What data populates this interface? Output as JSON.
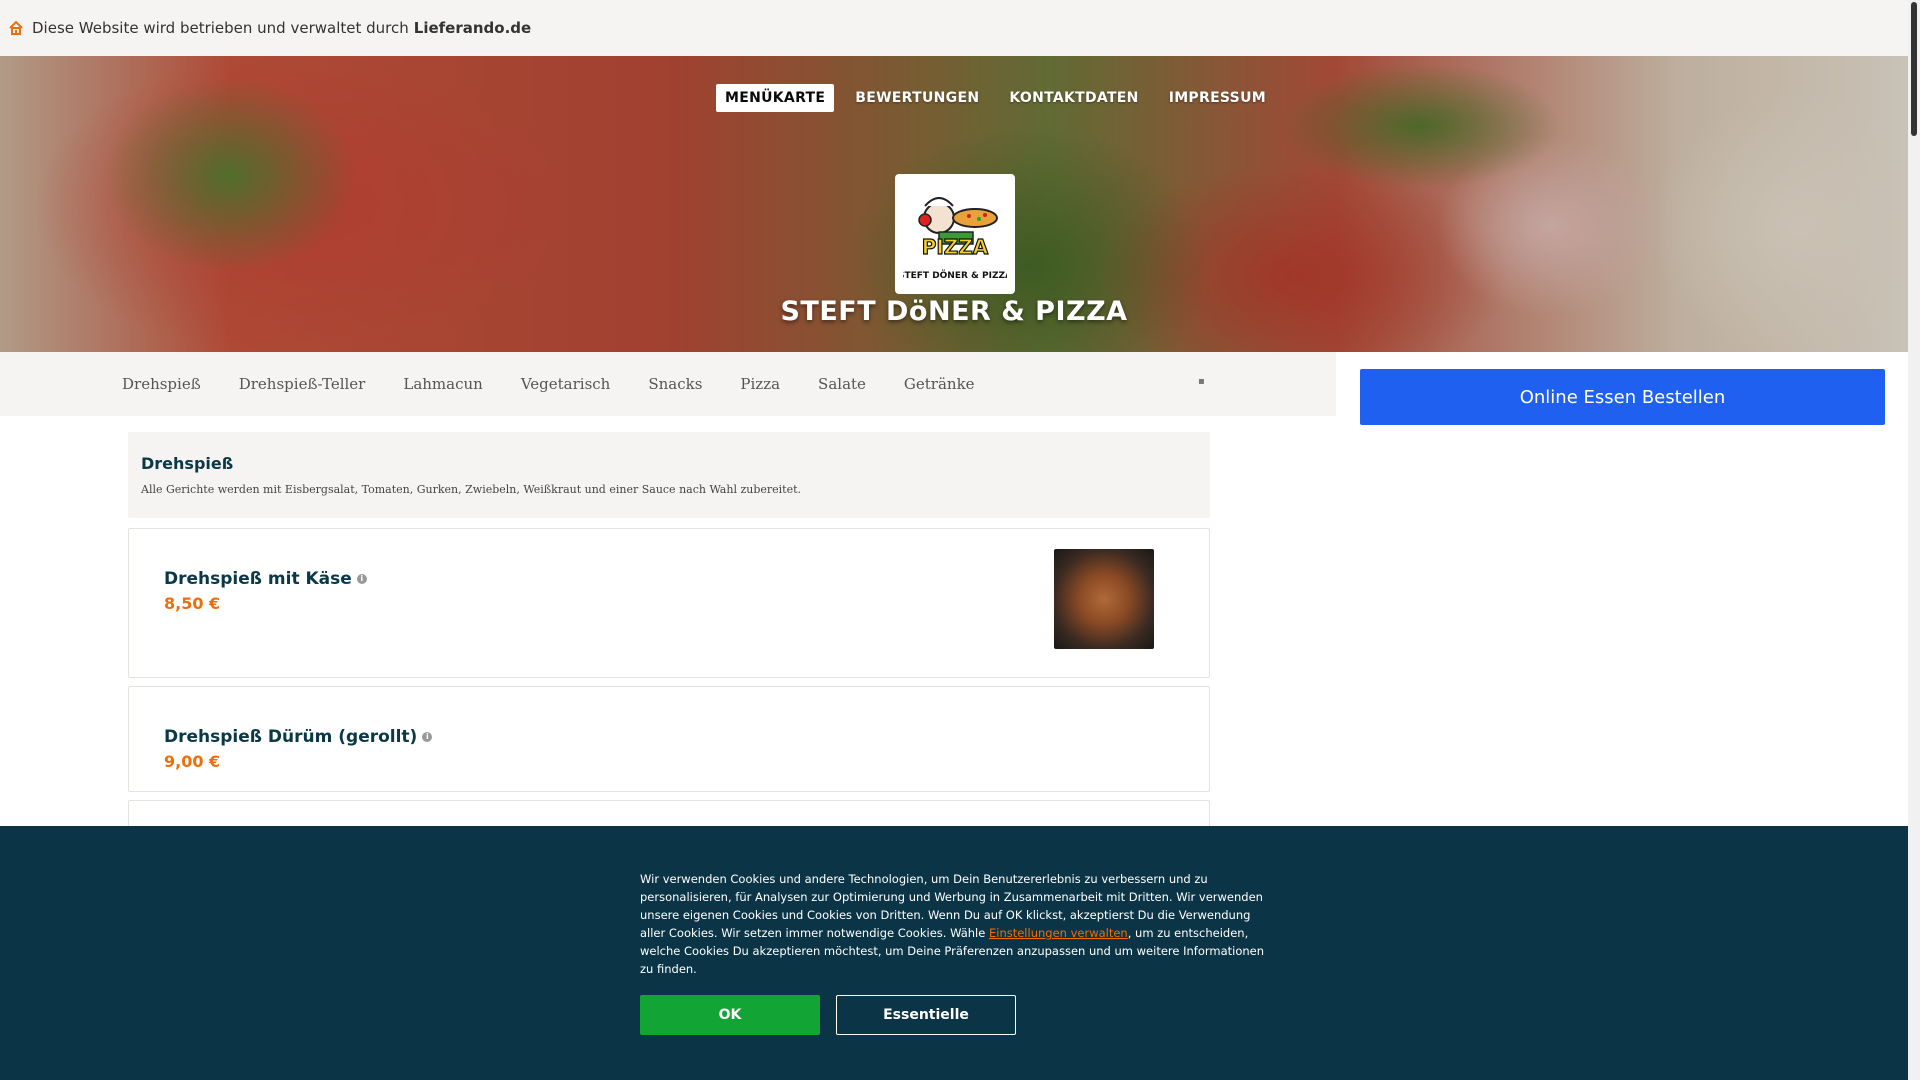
{
  "topbar": {
    "text": "Diese Website wird betrieben und verwaltet durch",
    "owner": "Lieferando.de",
    "icon": "home-icon"
  },
  "nav": {
    "items": [
      "MENÜKARTE",
      "BEWERTUNGEN",
      "KONTAKTDATEN",
      "IMPRESSUM"
    ],
    "active": "MENÜKARTE"
  },
  "restaurant": {
    "name": "STEFT DöNER & PIZZA",
    "logo_word": "PIZZA",
    "logo_sub": "STEFT DÖNER & PIZZA"
  },
  "categories": [
    "Drehspieß",
    "Drehspieß-Teller",
    "Lahmacun",
    "Vegetarisch",
    "Snacks",
    "Pizza",
    "Salate",
    "Getränke"
  ],
  "order_button": "Online Essen Bestellen",
  "section": {
    "title": "Drehspieß",
    "description": "Alle Gerichte werden mit Eisbergsalat, Tomaten, Gurken, Zwiebeln, Weißkraut und einer Sauce nach Wahl zubereitet."
  },
  "items": [
    {
      "name": "Drehspieß mit Käse",
      "price": "8,50 €"
    },
    {
      "name": "Drehspieß Dürüm (gerollt)",
      "price": "9,00 €"
    }
  ],
  "cookie": {
    "text_before": "Wir verwenden Cookies und andere Technologien, um Dein Benutzererlebnis zu verbessern und zu personalisieren, für Analysen zur Optimierung und Werbung in Zusammenarbeit mit Dritten. Wir verwenden unsere eigenen Cookies und Cookies von Dritten. Wenn Du auf OK klickst, akzeptierst Du die Verwendung aller Cookies. Wir setzen immer notwendige Cookies. Wähle ",
    "manage_link": "Einstellungen verwalten",
    "text_after": ", um zu entscheiden, welche Cookies Du akzeptieren möchtest, um Deine Präferenzen anzupassen und um weitere Informationen zu finden.",
    "ok": "OK",
    "essential": "Essentielle"
  },
  "colors": {
    "accent": "#f06e0a",
    "order_button": "#2060f0",
    "cookie_bg": "#0b3546",
    "ok_button": "#13a436"
  }
}
